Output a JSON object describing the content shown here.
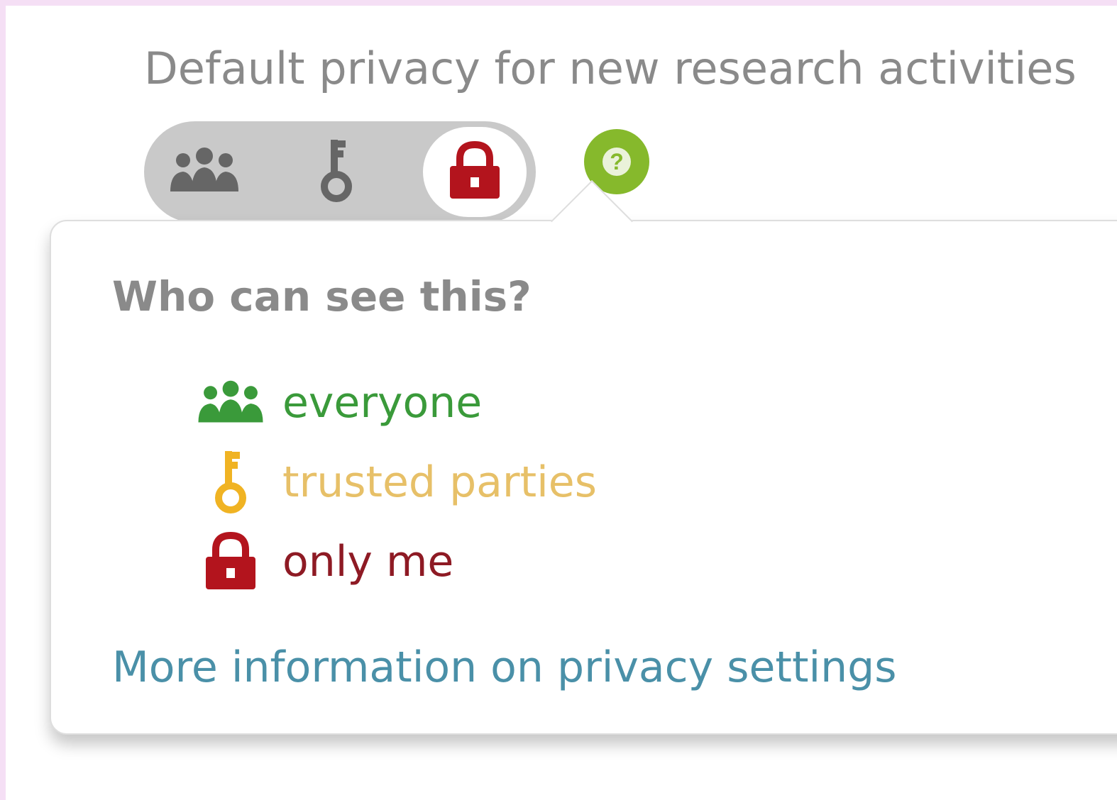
{
  "header": {
    "title": "Default privacy for new research activities"
  },
  "privacy_toggle": {
    "options": [
      {
        "name": "everyone",
        "icon": "group-icon",
        "selected": false
      },
      {
        "name": "trusted parties",
        "icon": "key-icon",
        "selected": false
      },
      {
        "name": "only me",
        "icon": "lock-icon",
        "selected": true
      }
    ]
  },
  "help_button": {
    "icon": "question-icon",
    "label": "?"
  },
  "popover": {
    "title": "Who can see this?",
    "legend": [
      {
        "label": "everyone",
        "icon": "group-icon",
        "color": "#3a9a3a"
      },
      {
        "label": "trusted parties",
        "icon": "key-icon",
        "color": "#e7c068"
      },
      {
        "label": "only me",
        "icon": "lock-icon",
        "color": "#8e1a24"
      }
    ],
    "link_text": "More information on privacy settings"
  },
  "colors": {
    "page_border": "#f5dff5",
    "toggle_bg": "#c9c9c9",
    "inactive_icon": "#666666",
    "help_green": "#86b92c",
    "link_blue": "#4a90a8"
  }
}
